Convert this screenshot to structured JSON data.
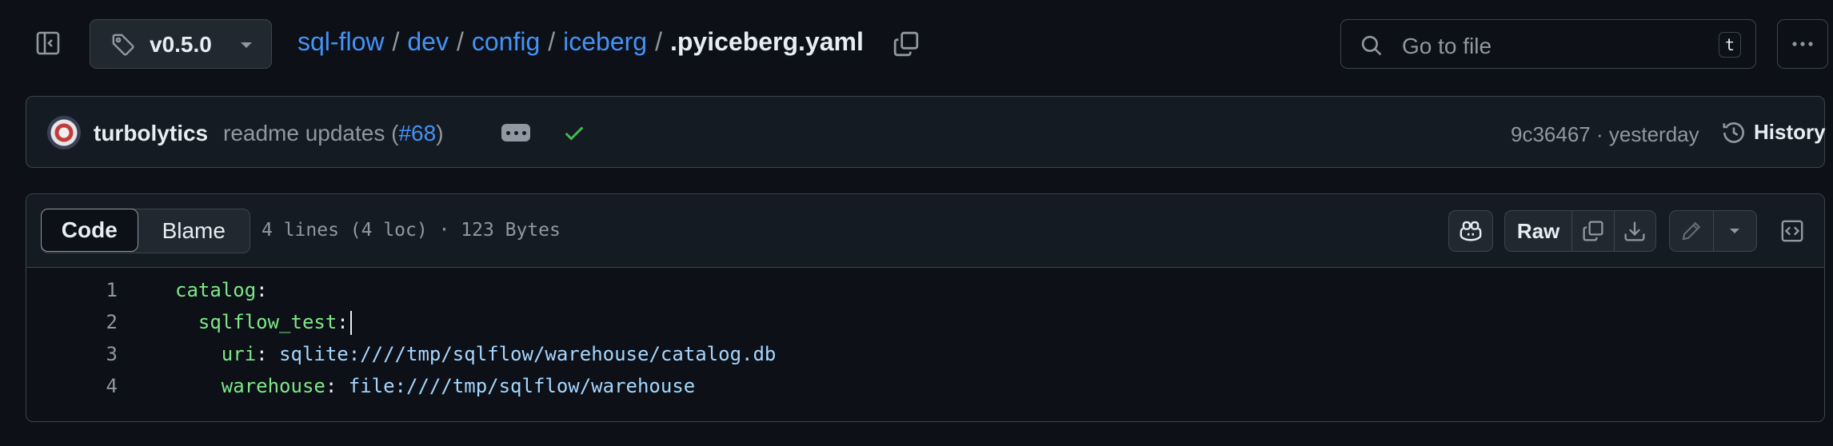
{
  "header": {
    "branch": "v0.5.0",
    "breadcrumb": [
      {
        "label": "sql-flow"
      },
      {
        "label": "dev"
      },
      {
        "label": "config"
      },
      {
        "label": "iceberg"
      }
    ],
    "separator": "/",
    "current_file": ".pyiceberg.yaml",
    "go_to_file_placeholder": "Go to file",
    "go_to_file_shortcut": "t"
  },
  "commit": {
    "author": "turbolytics",
    "message": "readme updates (",
    "pr": "#68",
    "message_end": ")",
    "sha": "9c36467",
    "dot": "·",
    "when": "yesterday",
    "history_label": "History",
    "status_color": "#3fb950"
  },
  "file": {
    "tabs": [
      "Code",
      "Blame"
    ],
    "active_tab": "Code",
    "meta": "4 lines (4 loc) · 123 Bytes",
    "raw_label": "Raw",
    "lines": [
      {
        "num": "1",
        "indent": "",
        "key": "catalog",
        "colon": ":",
        "value": ""
      },
      {
        "num": "2",
        "indent": "  ",
        "key": "sqlflow_test",
        "colon": ":",
        "value": ""
      },
      {
        "num": "3",
        "indent": "    ",
        "key": "uri",
        "colon": ": ",
        "value": "sqlite:////tmp/sqlflow/warehouse/catalog.db"
      },
      {
        "num": "4",
        "indent": "    ",
        "key": "warehouse",
        "colon": ": ",
        "value": "file:////tmp/sqlflow/warehouse"
      }
    ]
  },
  "colors": {
    "background": "#0d1117",
    "link": "#4493f8",
    "yaml_key": "#7ee787",
    "yaml_value": "#a5d6ff"
  }
}
